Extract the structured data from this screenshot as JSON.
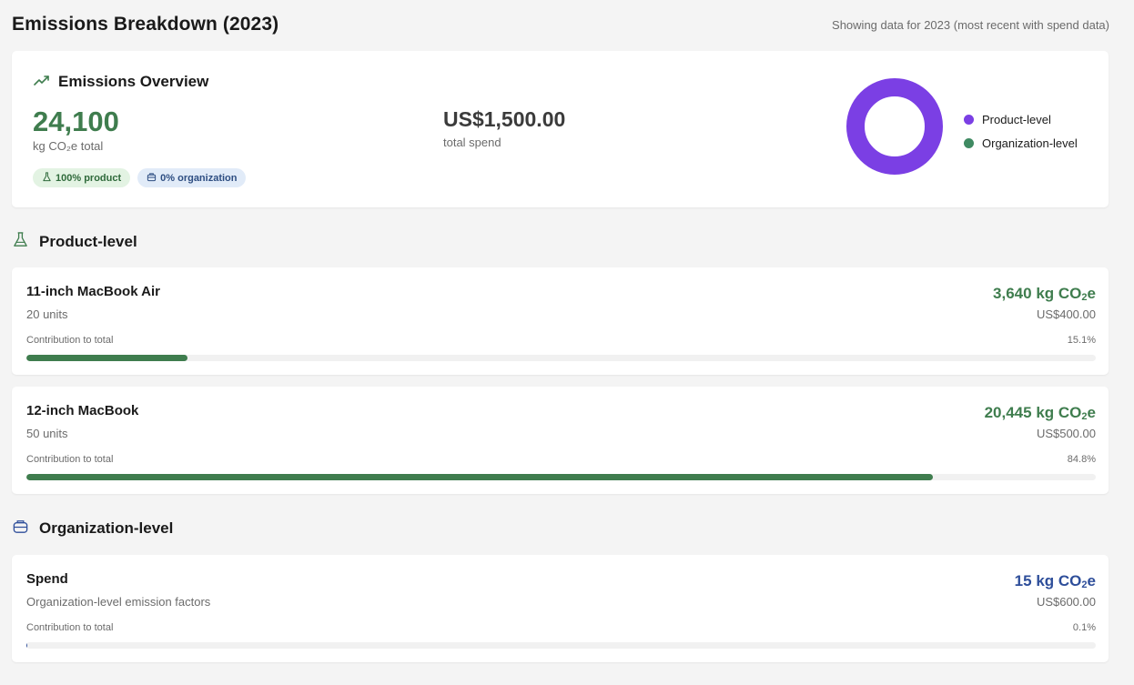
{
  "page": {
    "title": "Emissions Breakdown (2023)",
    "note": "Showing data for 2023 (most recent with spend data)"
  },
  "overview": {
    "title": "Emissions Overview",
    "icon": "trending-up-icon",
    "total_value": "24,100",
    "total_unit": "kg CO₂e total",
    "spend_value": "US$1,500.00",
    "spend_label": "total spend",
    "badges": [
      {
        "icon": "flask-icon",
        "label": "100% product"
      },
      {
        "icon": "building-icon",
        "label": "0% organization"
      }
    ],
    "donut": {
      "segments": [
        {
          "name": "Product-level",
          "fraction": 1.0,
          "color": "#7b3fe4"
        },
        {
          "name": "Organization-level",
          "fraction": 0.0,
          "color": "#3f8a62"
        }
      ]
    },
    "legend": [
      {
        "label": "Product-level",
        "color": "#7b3fe4"
      },
      {
        "label": "Organization-level",
        "color": "#3f8a62"
      }
    ]
  },
  "product_section": {
    "title": "Product-level",
    "icon": "flask-icon",
    "items": [
      {
        "name": "11-inch MacBook Air",
        "sub": "20 units",
        "emissions_num": "3,640",
        "emissions_unit": "kg CO",
        "emissions_tail": "e",
        "cost": "US$400.00",
        "contrib_label": "Contribution to total",
        "contrib_pct": "15.1%",
        "contrib_fraction": 0.151,
        "color": "#3f7d4e"
      },
      {
        "name": "12-inch MacBook",
        "sub": "50 units",
        "emissions_num": "20,445",
        "emissions_unit": "kg CO",
        "emissions_tail": "e",
        "cost": "US$500.00",
        "contrib_label": "Contribution to total",
        "contrib_pct": "84.8%",
        "contrib_fraction": 0.848,
        "color": "#3f7d4e"
      }
    ]
  },
  "organization_section": {
    "title": "Organization-level",
    "icon": "building-icon",
    "items": [
      {
        "name": "Spend",
        "sub": "Organization-level emission factors",
        "emissions_num": "15",
        "emissions_unit": "kg CO",
        "emissions_tail": "e",
        "cost": "US$600.00",
        "contrib_label": "Contribution to total",
        "contrib_pct": "0.1%",
        "contrib_fraction": 0.001,
        "color": "#2e4e9a"
      }
    ]
  },
  "colors": {
    "green": "#3f7d4e",
    "purple": "#7b3fe4",
    "blue": "#2e4e9a"
  }
}
